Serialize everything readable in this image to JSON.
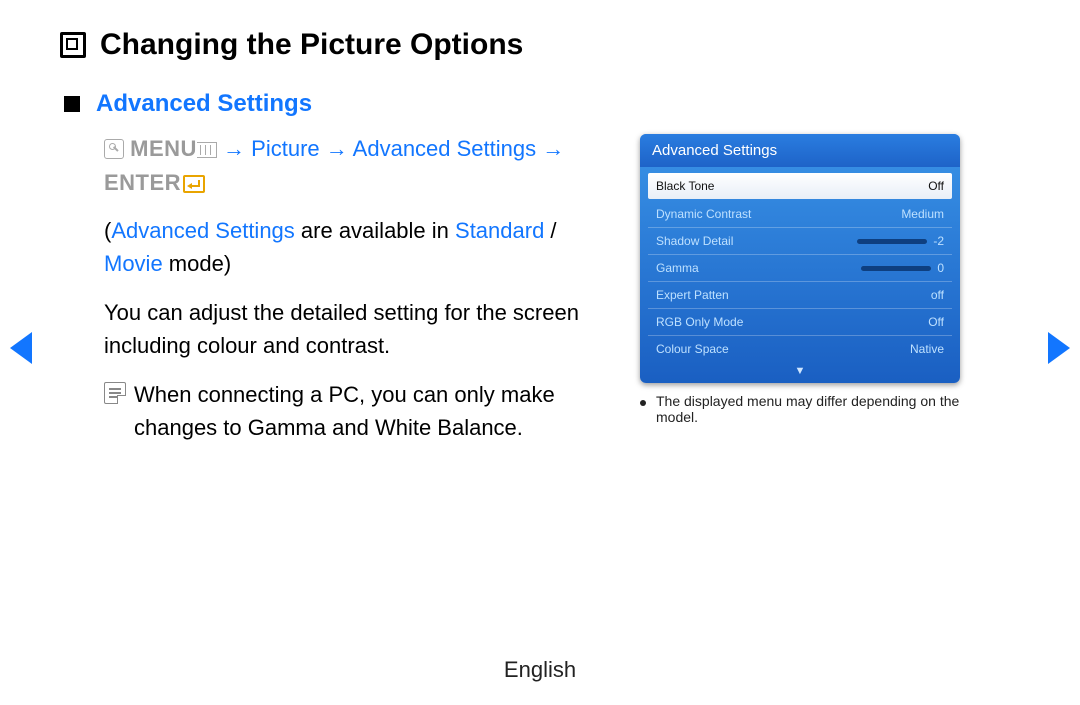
{
  "title": "Changing the Picture Options",
  "section_heading": "Advanced Settings",
  "path": {
    "menu": "MENU",
    "arrow": "→",
    "picture": "Picture",
    "adv": "Advanced Settings",
    "enter": "ENTER"
  },
  "mode_line": {
    "open": "(",
    "adv": "Advanced Settings",
    "mid": " are available in ",
    "std": "Standard",
    "slash": " / ",
    "movie": "Movie",
    "end": " mode)"
  },
  "para2": "You can adjust the detailed setting for the screen including colour and contrast.",
  "note": {
    "pre": "When connecting a PC, you can only make changes to ",
    "gamma": "Gamma",
    "and": " and ",
    "wb": "White Balance",
    "dot": "."
  },
  "osd": {
    "title": "Advanced Settings",
    "rows": [
      {
        "label": "Black Tone",
        "value": "Off",
        "selected": true
      },
      {
        "label": "Dynamic Contrast",
        "value": "Medium"
      },
      {
        "label": "Shadow Detail",
        "value": "-2",
        "slider": 45
      },
      {
        "label": "Gamma",
        "value": "0",
        "slider": 55
      },
      {
        "label": "Expert Patten",
        "value": "off"
      },
      {
        "label": "RGB Only Mode",
        "value": "Off"
      },
      {
        "label": "Colour Space",
        "value": "Native"
      }
    ],
    "more_indicator": "▼",
    "caption": "The displayed menu may differ depending on the model."
  },
  "footer_lang": "English"
}
